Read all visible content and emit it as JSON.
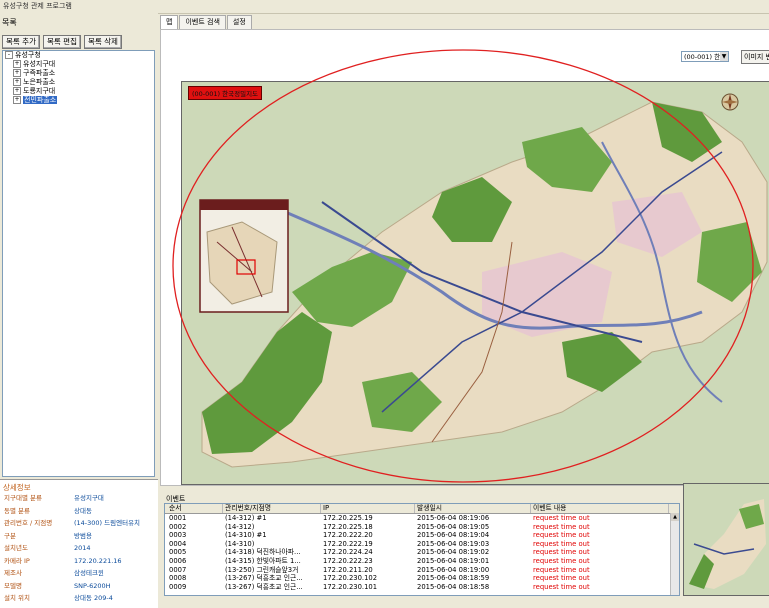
{
  "app": {
    "title": "유성구청 관제 프로그램"
  },
  "left_panel": {
    "tab_label": "목록",
    "buttons": {
      "add": "목록 추가",
      "edit": "목록 편집",
      "delete": "목록 삭제"
    },
    "tree": [
      {
        "label": "유성구청",
        "level": 0,
        "expander": "-",
        "selected": false
      },
      {
        "label": "유성지구대",
        "level": 1,
        "expander": "+",
        "selected": false
      },
      {
        "label": "구즉파출소",
        "level": 1,
        "expander": "+",
        "selected": false
      },
      {
        "label": "노은파출소",
        "level": 1,
        "expander": "+",
        "selected": false
      },
      {
        "label": "도룡지구대",
        "level": 1,
        "expander": "+",
        "selected": false
      },
      {
        "label": "전민파출소",
        "level": 1,
        "expander": "+",
        "selected": true
      }
    ]
  },
  "detail": {
    "title": "상세정보",
    "rows": [
      {
        "key": "지구대별 분류",
        "value": "유성지구대"
      },
      {
        "key": "동별 분류",
        "value": "상대동"
      },
      {
        "key": "관리번호 / 지점명",
        "value": "(14-300) 드림엔터유치"
      },
      {
        "key": "구분",
        "value": "방범용"
      },
      {
        "key": "설치년도",
        "value": "2014"
      },
      {
        "key": "카메라 IP",
        "value": "172.20.221.16"
      },
      {
        "key": "제조사",
        "value": "삼성테크윈"
      },
      {
        "key": "모델명",
        "value": "SNP-6200H"
      },
      {
        "key": "설치 위치",
        "value": "상대동 209-4"
      }
    ]
  },
  "main": {
    "tabs": [
      {
        "label": "맵",
        "active": true
      },
      {
        "label": "이벤트 검색",
        "active": false
      },
      {
        "label": "설정",
        "active": false
      }
    ],
    "map_selector": "(00-001) 한",
    "image_button": "이미지 변",
    "map_title": "(00-001) 한국정밀지도"
  },
  "events": {
    "label": "이벤트",
    "columns": [
      "순서",
      "관리번호/지점명",
      "IP",
      "발생일시",
      "이벤트 내용"
    ],
    "rows": [
      [
        "0001",
        "(14-312) #1",
        "172.20.225.19",
        "2015-06-04 08:19:06",
        "request time out"
      ],
      [
        "0002",
        "(14-312)",
        "172.20.225.18",
        "2015-06-04 08:19:05",
        "request time out"
      ],
      [
        "0003",
        "(14-310) #1",
        "172.20.222.20",
        "2015-06-04 08:19:04",
        "request time out"
      ],
      [
        "0004",
        "(14-310)",
        "172.20.222.19",
        "2015-06-04 08:19:03",
        "request time out"
      ],
      [
        "0005",
        "(14-318) 덕진하나아파...",
        "172.20.224.24",
        "2015-06-04 08:19:02",
        "request time out"
      ],
      [
        "0006",
        "(14-315) 한빛아파트 1...",
        "172.20.222.23",
        "2015-06-04 08:19:01",
        "request time out"
      ],
      [
        "0007",
        "(13-250) 그린캐슬앞3거",
        "172.20.211.20",
        "2015-06-04 08:19:00",
        "request time out"
      ],
      [
        "0008",
        "(13-267) 덕흥초교 인근...",
        "172.20.230.102",
        "2015-06-04 08:18:59",
        "request time out"
      ],
      [
        "0009",
        "(13-267) 덕흥초교 인근...",
        "172.20.230.101",
        "2015-06-04 08:18:58",
        "request time out"
      ]
    ]
  },
  "colors": {
    "window_bg": "#ece9d8",
    "selection": "#316ac5",
    "event_text": "#e00000",
    "annotation": "#e02020"
  }
}
